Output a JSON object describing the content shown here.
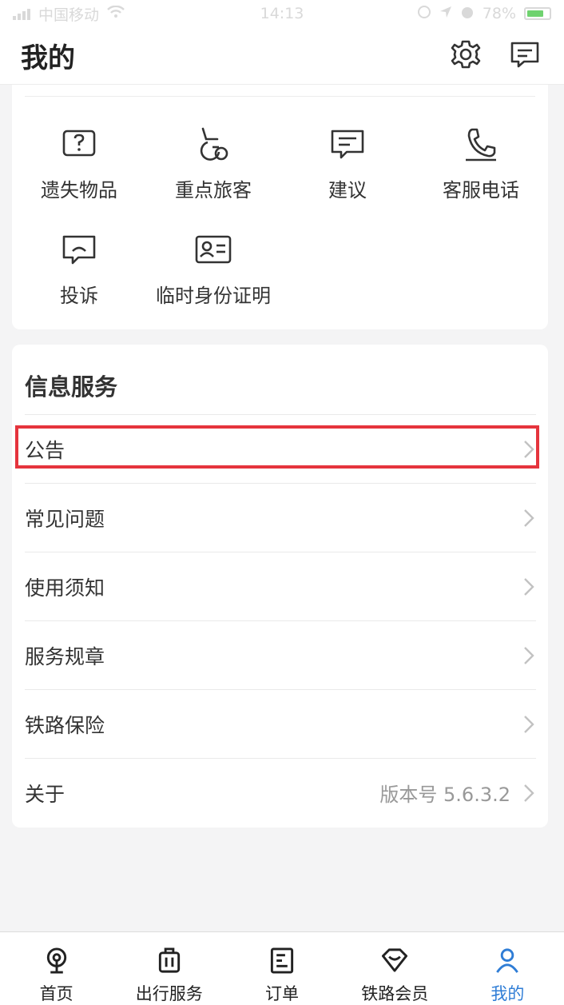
{
  "status_bar": {
    "carrier": "中国移动",
    "time": "14:13",
    "battery": "78%"
  },
  "header": {
    "title": "我的",
    "settings_icon": "gear-icon",
    "message_icon": "message-icon"
  },
  "quick_services": [
    {
      "label": "遗失物品",
      "icon": "question-box-icon"
    },
    {
      "label": "重点旅客",
      "icon": "wheelchair-icon"
    },
    {
      "label": "建议",
      "icon": "comment-icon"
    },
    {
      "label": "客服电话",
      "icon": "phone-icon"
    },
    {
      "label": "投诉",
      "icon": "complaint-icon"
    },
    {
      "label": "临时身份证明",
      "icon": "id-card-icon"
    }
  ],
  "info_service": {
    "title": "信息服务",
    "rows": [
      {
        "label": "公告",
        "value": ""
      },
      {
        "label": "常见问题",
        "value": ""
      },
      {
        "label": "使用须知",
        "value": ""
      },
      {
        "label": "服务规章",
        "value": ""
      },
      {
        "label": "铁路保险",
        "value": ""
      },
      {
        "label": "关于",
        "value": "版本号 5.6.3.2"
      }
    ]
  },
  "colors": {
    "accent": "#2f7dd6",
    "highlight": "#e5343d"
  },
  "tabbar": [
    {
      "label": "首页",
      "icon": "home-icon"
    },
    {
      "label": "出行服务",
      "icon": "luggage-icon"
    },
    {
      "label": "订单",
      "icon": "order-icon"
    },
    {
      "label": "铁路会员",
      "icon": "diamond-icon"
    },
    {
      "label": "我的",
      "icon": "user-icon"
    }
  ]
}
